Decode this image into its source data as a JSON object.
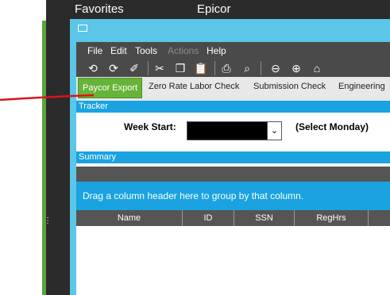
{
  "taskbar": {
    "favorites_label": "Favorites",
    "app_label": "Epicor"
  },
  "menu": [
    {
      "label": "File",
      "enabled": true
    },
    {
      "label": "Edit",
      "enabled": true
    },
    {
      "label": "Tools",
      "enabled": true
    },
    {
      "label": "Actions",
      "enabled": false
    },
    {
      "label": "Help",
      "enabled": true
    }
  ],
  "toolbar_icons": [
    "refresh-icon",
    "sync-icon",
    "clear-icon",
    "cut-icon",
    "copy-icon",
    "paste-icon",
    "print-icon",
    "print-preview-icon",
    "back-icon",
    "forward-icon",
    "home-icon"
  ],
  "tabs": [
    {
      "label": "Paycor Export",
      "active": true
    },
    {
      "label": "Zero Rate Labor Check",
      "active": false
    },
    {
      "label": "Submission Check",
      "active": false
    },
    {
      "label": "Engineering",
      "active": false
    }
  ],
  "tracker": {
    "section_label": "Tracker",
    "week_start_label": "Week Start:",
    "week_start_value": "",
    "hint": "(Select Monday)"
  },
  "summary": {
    "section_label": "Summary",
    "group_by_hint": "Drag a column header here to group by that column.",
    "columns": [
      "Name",
      "ID",
      "SSN",
      "RegHrs"
    ]
  },
  "colors": {
    "accent_blue": "#1aa3e0",
    "frame_blue": "#5bc6e8",
    "active_tab_green": "#68b43a",
    "annotation_red": "#d9141b"
  }
}
